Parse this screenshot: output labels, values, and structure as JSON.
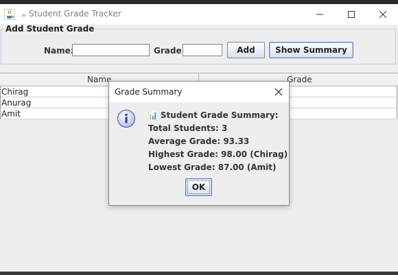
{
  "window": {
    "title_glyph": "☕",
    "title": "Student Grade Tracker"
  },
  "form": {
    "legend": "Add Student Grade",
    "name_label": "Name:",
    "name_value": "",
    "grade_label": "Grade:",
    "grade_value": "",
    "add_button": "Add",
    "summary_button": "Show Summary"
  },
  "table": {
    "columns": [
      "Name",
      "Grade"
    ],
    "rows": [
      {
        "name": "Chirag"
      },
      {
        "name": "Anurag"
      },
      {
        "name": "Amit"
      }
    ]
  },
  "dialog": {
    "title": "Grade Summary",
    "icon": "info-icon",
    "heading_glyph": "📊",
    "heading": "Student Grade Summary:",
    "lines": [
      "Total Students: 3",
      "Average Grade: 93.33",
      "Highest Grade: 98.00 (Chirag)",
      "Lowest Grade: 87.00 (Amit)"
    ],
    "ok_button": "OK"
  }
}
